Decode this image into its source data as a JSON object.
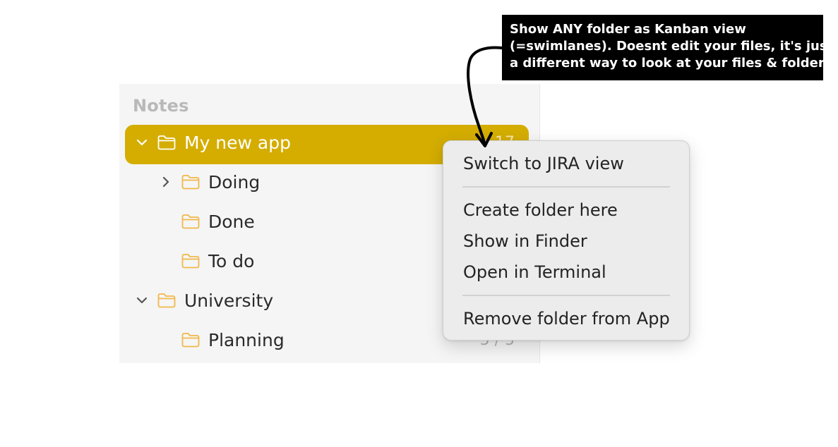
{
  "sidebar": {
    "section_title": "Notes",
    "rows": [
      {
        "label": "My new app",
        "count": "17",
        "expanded": true,
        "selected": true
      },
      {
        "label": "Doing",
        "count": "",
        "expanded": false,
        "selected": false
      },
      {
        "label": "Done",
        "count": "",
        "selected": false
      },
      {
        "label": "To do",
        "count": "",
        "selected": false
      },
      {
        "label": "University",
        "count": "",
        "expanded": true,
        "selected": false
      },
      {
        "label": "Planning",
        "count": "5 / 5",
        "selected": false
      }
    ]
  },
  "context_menu": {
    "items": [
      {
        "label": "Switch to JIRA view"
      },
      {
        "label": "Create folder here"
      },
      {
        "label": "Show in Finder"
      },
      {
        "label": "Open in Terminal"
      },
      {
        "label": "Remove folder from App"
      }
    ]
  },
  "callout": {
    "lines": [
      "Show ANY folder as Kanban view",
      "(=swimlanes). Doesnt edit your files, it's just",
      "a different way to look at your files & folders."
    ]
  },
  "colors": {
    "selection": "#d4ad00",
    "folder_icon": "#f0b84a",
    "sidebar_bg": "#f5f5f5",
    "menu_bg": "#ececec",
    "callout_bg": "#000000"
  },
  "icons": {
    "folder": "folder-icon",
    "chevron_down": "chevron-down-icon",
    "chevron_right": "chevron-right-icon"
  }
}
